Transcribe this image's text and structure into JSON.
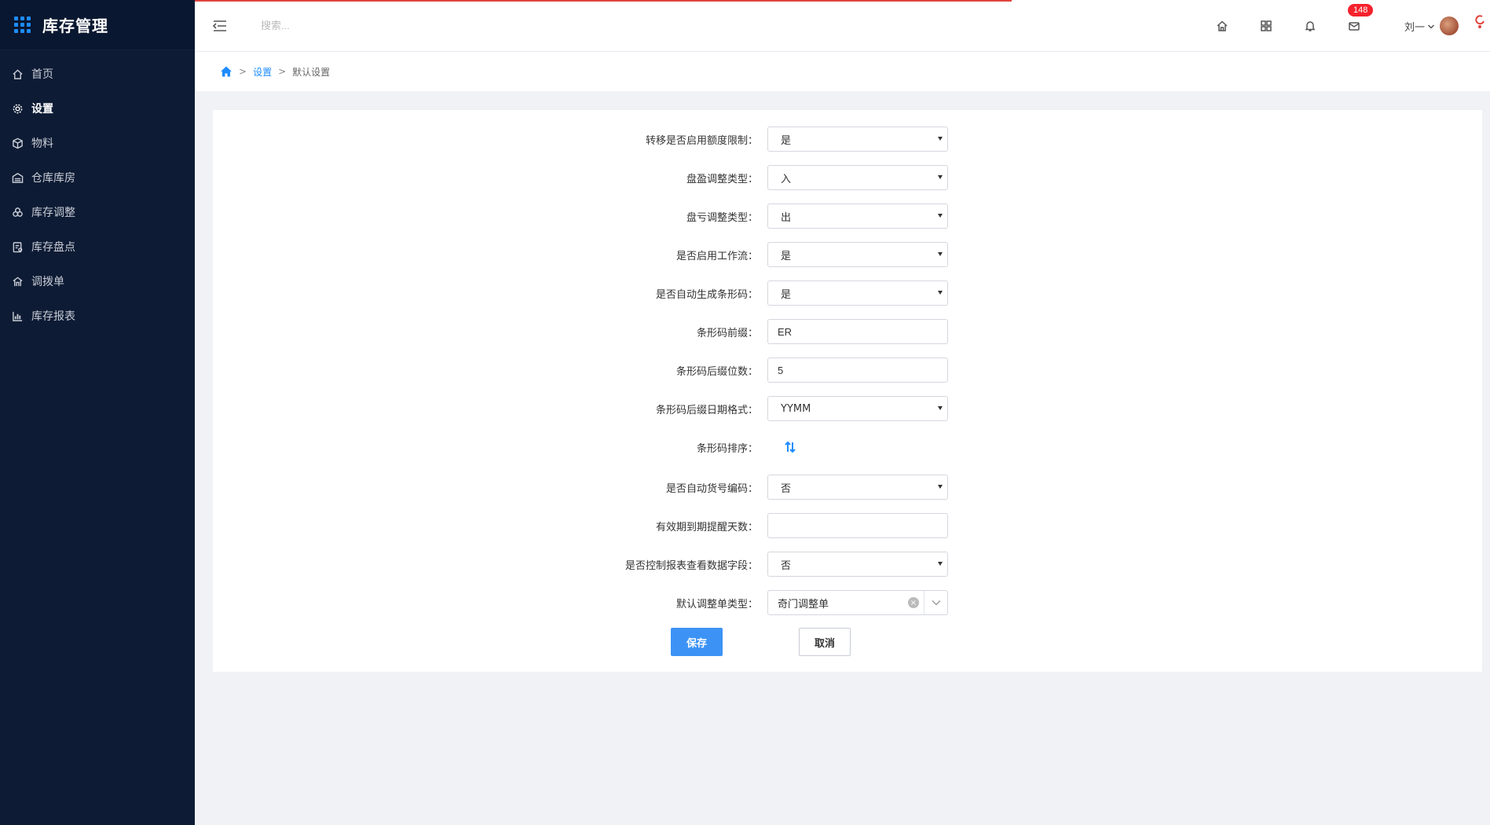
{
  "app": {
    "title": "库存管理"
  },
  "sidebar": {
    "items": [
      {
        "label": "首页",
        "icon": "home-icon"
      },
      {
        "label": "设置",
        "icon": "gear-icon"
      },
      {
        "label": "物料",
        "icon": "cube-icon"
      },
      {
        "label": "仓库库房",
        "icon": "warehouse-icon"
      },
      {
        "label": "库存调整",
        "icon": "adjust-icon"
      },
      {
        "label": "库存盘点",
        "icon": "clipboard-icon"
      },
      {
        "label": "调拨单",
        "icon": "transfer-icon"
      },
      {
        "label": "库存报表",
        "icon": "bar-chart-icon"
      }
    ],
    "active_index": 1
  },
  "header": {
    "search_placeholder": "搜索...",
    "badge_count": "148",
    "user_name": "刘一"
  },
  "breadcrumb": {
    "link": "设置",
    "current": "默认设置",
    "sep": ">"
  },
  "form": {
    "transfer_limit": {
      "label": "转移是否启用额度限制：",
      "value": "是"
    },
    "surplus_type": {
      "label": "盘盈调整类型：",
      "value": "入"
    },
    "loss_type": {
      "label": "盘亏调整类型：",
      "value": "出"
    },
    "workflow": {
      "label": "是否启用工作流：",
      "value": "是"
    },
    "auto_barcode": {
      "label": "是否自动生成条形码：",
      "value": "是"
    },
    "barcode_prefix": {
      "label": "条形码前缀：",
      "value": "ER"
    },
    "barcode_suffix_digits": {
      "label": "条形码后缀位数：",
      "value": "5"
    },
    "barcode_date_format": {
      "label": "条形码后缀日期格式：",
      "value": "YYMM"
    },
    "barcode_sort": {
      "label": "条形码排序："
    },
    "auto_item_code": {
      "label": "是否自动货号编码：",
      "value": "否"
    },
    "expiry_days": {
      "label": "有效期到期提醒天数：",
      "value": ""
    },
    "report_field_control": {
      "label": "是否控制报表查看数据字段：",
      "value": "否"
    },
    "default_adjust_type": {
      "label": "默认调整单类型：",
      "value": "奇门调整单"
    }
  },
  "buttons": {
    "save": "保存",
    "cancel": "取消"
  },
  "colors": {
    "sidebar_bg": "#0d1b34",
    "accent": "#1e8cff",
    "primary_button": "#3d93f5",
    "badge": "#f5222d"
  }
}
